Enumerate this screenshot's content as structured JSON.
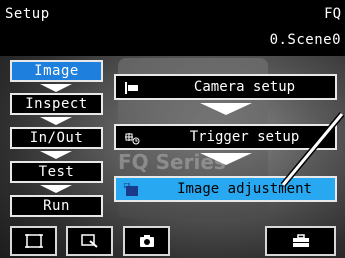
{
  "header": {
    "title": "Setup",
    "scene_number": "FQ",
    "scene_name": "0.Scene0"
  },
  "background_text": "FQ Series",
  "sidebar": {
    "items": [
      {
        "label": "Image",
        "active": true
      },
      {
        "label": "Inspect",
        "active": false
      },
      {
        "label": "In/Out",
        "active": false
      },
      {
        "label": "Test",
        "active": false
      },
      {
        "label": "Run",
        "active": false
      }
    ]
  },
  "main": {
    "buttons": [
      {
        "label": "Camera setup",
        "icon": "camera-setup-icon"
      },
      {
        "label": "Trigger setup",
        "icon": "trigger-icon"
      },
      {
        "label": "Image adjustment",
        "icon": "image-adjustment-icon",
        "highlighted": true
      }
    ]
  },
  "toolbar": {
    "buttons": [
      {
        "icon": "frame-icon"
      },
      {
        "icon": "zoom-icon"
      },
      {
        "icon": "capture-camera-icon"
      },
      {
        "icon": "toolbox-icon"
      }
    ]
  },
  "colors": {
    "active_blue": "#1f7fdc",
    "highlight_blue": "#27a8f0"
  }
}
